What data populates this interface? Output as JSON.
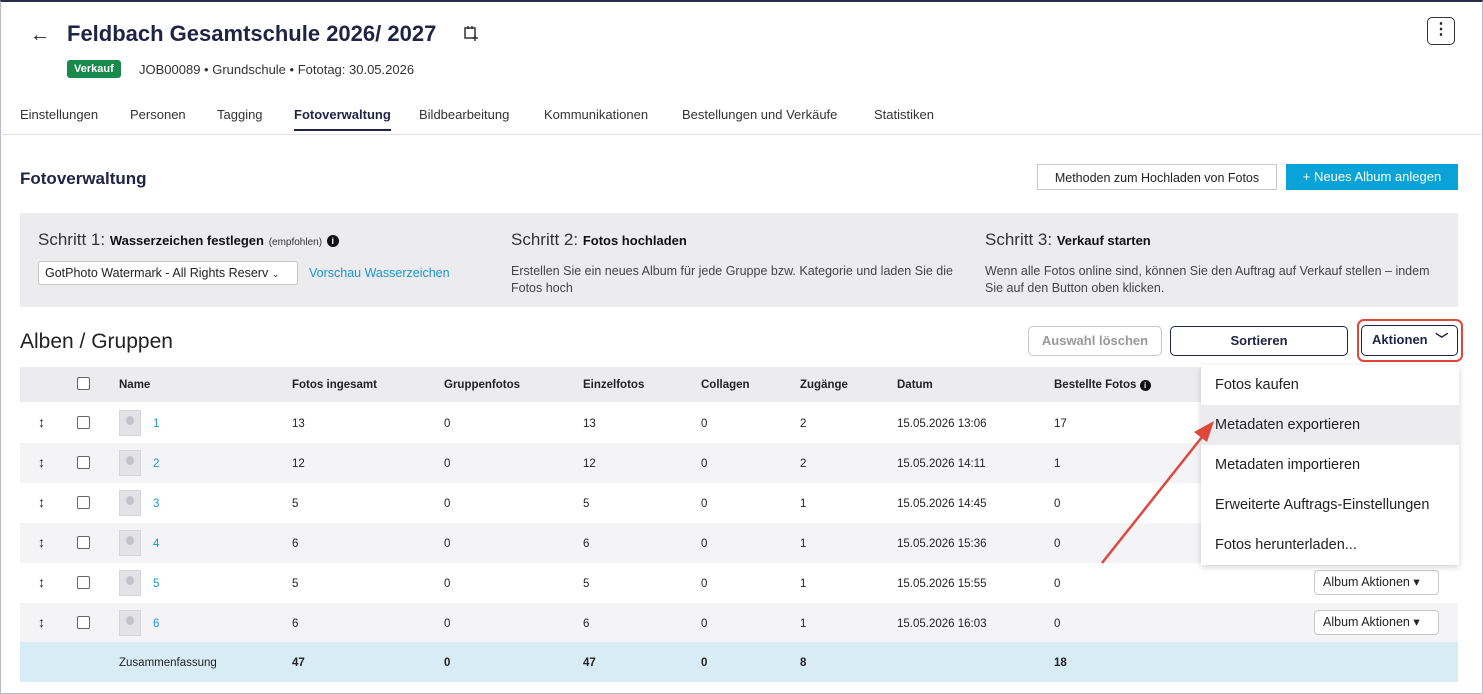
{
  "header": {
    "title": "Feldbach Gesamtschule 2026/ 2027",
    "badge": "Verkauf",
    "meta": "JOB00089  •  Grundschule  •  Fototag: 30.05.2026"
  },
  "tabs": [
    "Einstellungen",
    "Personen",
    "Tagging",
    "Fotoverwaltung",
    "Bildbearbeitung",
    "Kommunikationen",
    "Bestellungen und Verkäufe",
    "Statistiken"
  ],
  "section": {
    "title": "Fotoverwaltung",
    "upload_btn": "Methoden zum Hochladen von Fotos",
    "new_album_btn": "+  Neues Album anlegen"
  },
  "steps": {
    "s1_prefix": "Schritt 1: ",
    "s1_title": "Wasserzeichen festlegen",
    "s1_note": "(empfohlen)",
    "s1_select": "GotPhoto Watermark - All Rights Reserv",
    "s1_link": "Vorschau Wasserzeichen",
    "s2_prefix": "Schritt 2: ",
    "s2_title": "Fotos hochladen",
    "s2_text": "Erstellen Sie ein neues Album für jede Gruppe bzw. Kategorie und laden Sie die Fotos hoch",
    "s3_prefix": "Schritt 3: ",
    "s3_title": "Verkauf starten",
    "s3_text": "Wenn alle Fotos online sind, können Sie den Auftrag auf Verkauf stellen – indem Sie auf den Button oben klicken."
  },
  "albums": {
    "title": "Alben / Gruppen",
    "clear_btn": "Auswahl löschen",
    "sort_btn": "Sortieren",
    "actions_btn": "Aktionen",
    "columns": [
      "Name",
      "Fotos ingesamt",
      "Gruppenfotos",
      "Einzelfotos",
      "Collagen",
      "Zugänge",
      "Datum",
      "Bestellte Fotos"
    ],
    "rows": [
      [
        "1",
        "13",
        "0",
        "13",
        "0",
        "2",
        "15.05.2026 13:06",
        "17"
      ],
      [
        "2",
        "12",
        "0",
        "12",
        "0",
        "2",
        "15.05.2026 14:11",
        "1"
      ],
      [
        "3",
        "5",
        "0",
        "5",
        "0",
        "1",
        "15.05.2026 14:45",
        "0"
      ],
      [
        "4",
        "6",
        "0",
        "6",
        "0",
        "1",
        "15.05.2026 15:36",
        "0"
      ],
      [
        "5",
        "5",
        "0",
        "5",
        "0",
        "1",
        "15.05.2026 15:55",
        "0"
      ],
      [
        "6",
        "6",
        "0",
        "6",
        "0",
        "1",
        "15.05.2026 16:03",
        "0"
      ]
    ],
    "album_action_btn": "Album Aktionen ▾",
    "summary": [
      "Zusammenfassung",
      "47",
      "0",
      "47",
      "0",
      "8",
      "",
      "18"
    ]
  },
  "menu": [
    "Fotos kaufen",
    "Metadaten exportieren",
    "Metadaten importieren",
    "Erweiterte Auftrags-Einstellungen",
    "Fotos herunterladen..."
  ],
  "colors": {
    "accent": "#0aa3d8",
    "badge": "#1a8a4c",
    "highlight": "#e0473b"
  }
}
